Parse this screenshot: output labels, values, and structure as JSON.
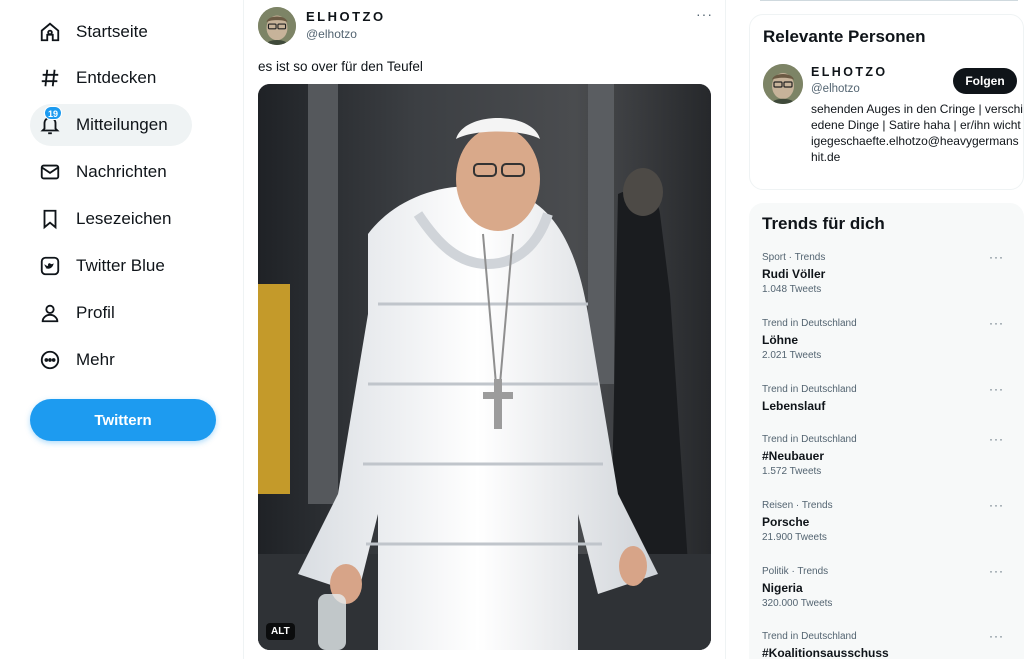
{
  "nav": {
    "items": [
      {
        "label": "Startseite",
        "icon": "home-icon"
      },
      {
        "label": "Entdecken",
        "icon": "hashtag-icon"
      },
      {
        "label": "Mitteilungen",
        "icon": "bell-icon",
        "badge": "19"
      },
      {
        "label": "Nachrichten",
        "icon": "envelope-icon"
      },
      {
        "label": "Lesezeichen",
        "icon": "bookmark-icon"
      },
      {
        "label": "Twitter Blue",
        "icon": "twitter-blue-icon"
      },
      {
        "label": "Profil",
        "icon": "person-icon"
      },
      {
        "label": "Mehr",
        "icon": "more-circle-icon"
      }
    ],
    "tweet_button": "Twittern"
  },
  "tweet": {
    "author_name": "ELHOTZO",
    "author_handle": "@elhotzo",
    "text": "es ist so over für den Teufel",
    "more": "···",
    "alt_badge": "ALT"
  },
  "relevant": {
    "title": "Relevante Personen",
    "person": {
      "name": "ELHOTZO",
      "handle": "@elhotzo",
      "follow_label": "Folgen",
      "bio": "sehenden Auges in den Cringe | verschiedene Dinge | Satire haha | er/ihn wichtigegeschaefte.elhotzo@heavygermanshit.de"
    }
  },
  "trends": {
    "title": "Trends für dich",
    "items": [
      {
        "context": "Sport · Trends",
        "name": "Rudi Völler",
        "count": "1.048 Tweets"
      },
      {
        "context": "Trend in Deutschland",
        "name": "Löhne",
        "count": "2.021 Tweets"
      },
      {
        "context": "Trend in Deutschland",
        "name": "Lebenslauf",
        "count": ""
      },
      {
        "context": "Trend in Deutschland",
        "name": "#Neubauer",
        "count": "1.572 Tweets"
      },
      {
        "context": "Reisen · Trends",
        "name": "Porsche",
        "count": "21.900 Tweets"
      },
      {
        "context": "Politik · Trends",
        "name": "Nigeria",
        "count": "320.000 Tweets"
      },
      {
        "context": "Trend in Deutschland",
        "name": "#Koalitionsausschuss",
        "count": ""
      }
    ]
  },
  "colors": {
    "accent": "#1d9bf0",
    "text": "#0f1419",
    "muted": "#536471",
    "panel": "#f7f9f9"
  }
}
